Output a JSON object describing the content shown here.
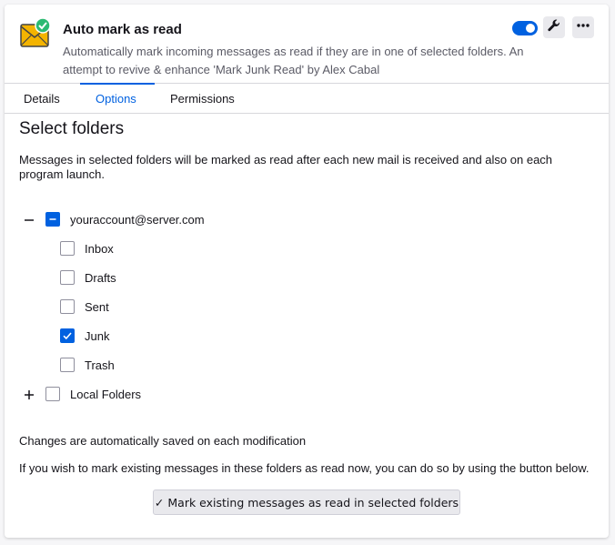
{
  "header": {
    "title": "Auto mark as read",
    "description": "Automatically mark incoming messages as read if they are in one of selected folders. An attempt to revive & enhance 'Mark Junk Read' by Alex Cabal",
    "enabled": true,
    "icons": {
      "extension": "envelope-check-icon",
      "preferences": "wrench-icon",
      "more": "ellipsis-icon"
    }
  },
  "tabs": [
    {
      "label": "Details",
      "active": false
    },
    {
      "label": "Options",
      "active": true
    },
    {
      "label": "Permissions",
      "active": false
    }
  ],
  "options": {
    "heading": "Select folders",
    "intro": "Messages in selected folders will be marked as read after each new mail is received and also on each program launch.",
    "tree": {
      "account": {
        "label": "youraccount@server.com",
        "expanded": true,
        "state": "mixed"
      },
      "folders": [
        {
          "label": "Inbox",
          "checked": false
        },
        {
          "label": "Drafts",
          "checked": false
        },
        {
          "label": "Sent",
          "checked": false
        },
        {
          "label": "Junk",
          "checked": true
        },
        {
          "label": "Trash",
          "checked": false
        }
      ],
      "local": {
        "label": "Local Folders",
        "expanded": false,
        "checked": false
      }
    },
    "autosave_note": "Changes are automatically saved on each modification",
    "hint": "If you wish to mark existing messages in these folders as read now, you can do so by using the button below.",
    "action_label": "✓ Mark existing messages as read in selected folders"
  },
  "colors": {
    "accent": "#0061e0",
    "envelope": "#f4b400",
    "check": "#2cba72"
  }
}
